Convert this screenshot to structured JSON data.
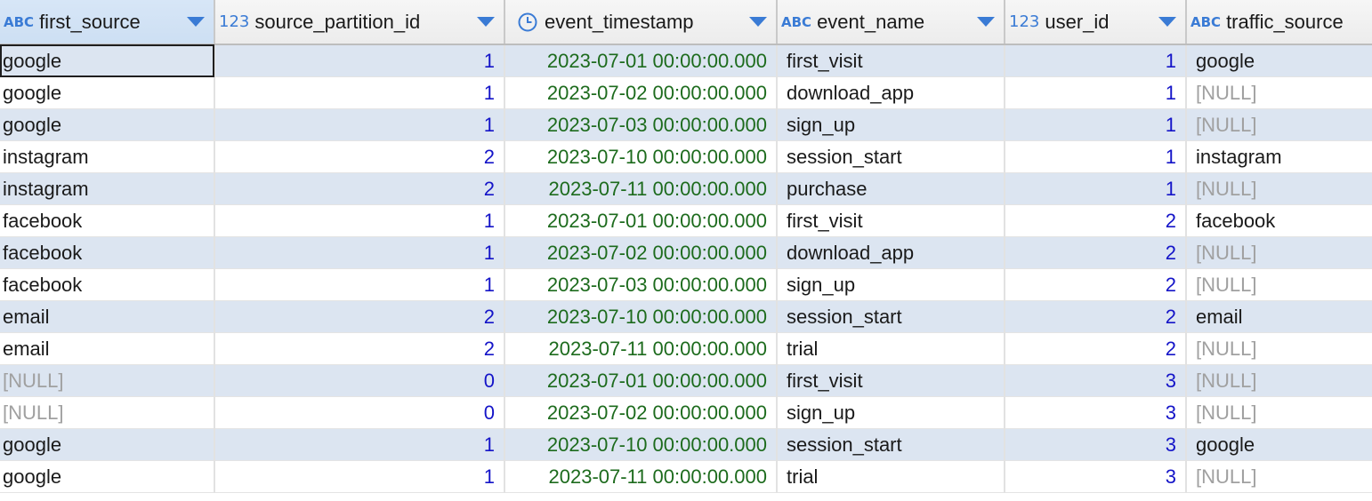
{
  "columns": [
    {
      "name": "first_source",
      "type": "ABC"
    },
    {
      "name": "source_partition_id",
      "type": "123"
    },
    {
      "name": "event_timestamp",
      "type": "clock"
    },
    {
      "name": "event_name",
      "type": "ABC"
    },
    {
      "name": "user_id",
      "type": "123"
    },
    {
      "name": "traffic_source",
      "type": "ABC"
    }
  ],
  "type_labels": {
    "text": "ABC",
    "number": "123"
  },
  "colors": {
    "header_bg": "#ececec",
    "row_alt_bg": "#dce5f1",
    "number_text": "#1414c8",
    "timestamp_text": "#1d6b1d",
    "null_text": "#a0a0a0",
    "accent": "#3a7bd5"
  },
  "rows": [
    [
      "google",
      "1",
      "2023-07-01 00:00:00.000",
      "first_visit",
      "1",
      "google"
    ],
    [
      "google",
      "1",
      "2023-07-02 00:00:00.000",
      "download_app",
      "1",
      "[NULL]"
    ],
    [
      "google",
      "1",
      "2023-07-03 00:00:00.000",
      "sign_up",
      "1",
      "[NULL]"
    ],
    [
      "instagram",
      "2",
      "2023-07-10 00:00:00.000",
      "session_start",
      "1",
      "instagram"
    ],
    [
      "instagram",
      "2",
      "2023-07-11 00:00:00.000",
      "purchase",
      "1",
      "[NULL]"
    ],
    [
      "facebook",
      "1",
      "2023-07-01 00:00:00.000",
      "first_visit",
      "2",
      "facebook"
    ],
    [
      "facebook",
      "1",
      "2023-07-02 00:00:00.000",
      "download_app",
      "2",
      "[NULL]"
    ],
    [
      "facebook",
      "1",
      "2023-07-03 00:00:00.000",
      "sign_up",
      "2",
      "[NULL]"
    ],
    [
      "email",
      "2",
      "2023-07-10 00:00:00.000",
      "session_start",
      "2",
      "email"
    ],
    [
      "email",
      "2",
      "2023-07-11 00:00:00.000",
      "trial",
      "2",
      "[NULL]"
    ],
    [
      "[NULL]",
      "0",
      "2023-07-01 00:00:00.000",
      "first_visit",
      "3",
      "[NULL]"
    ],
    [
      "[NULL]",
      "0",
      "2023-07-02 00:00:00.000",
      "sign_up",
      "3",
      "[NULL]"
    ],
    [
      "google",
      "1",
      "2023-07-10 00:00:00.000",
      "session_start",
      "3",
      "google"
    ],
    [
      "google",
      "1",
      "2023-07-11 00:00:00.000",
      "trial",
      "3",
      "[NULL]"
    ]
  ]
}
